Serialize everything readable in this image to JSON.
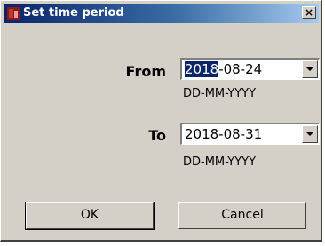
{
  "window": {
    "title": "Set time period",
    "close_glyph": "×",
    "icon": "app-icon"
  },
  "from": {
    "label": "From",
    "value_selected": "2018",
    "value_rest": "-08-24",
    "hint": "DD-MM-YYYY"
  },
  "to": {
    "label": "To",
    "value": "2018-08-31",
    "hint": "DD-MM-YYYY"
  },
  "buttons": {
    "ok": "OK",
    "cancel": "Cancel"
  },
  "colors": {
    "dialog_bg": "#d4d0c8",
    "titlebar_start": "#0a246a",
    "selection": "#0a246a"
  }
}
